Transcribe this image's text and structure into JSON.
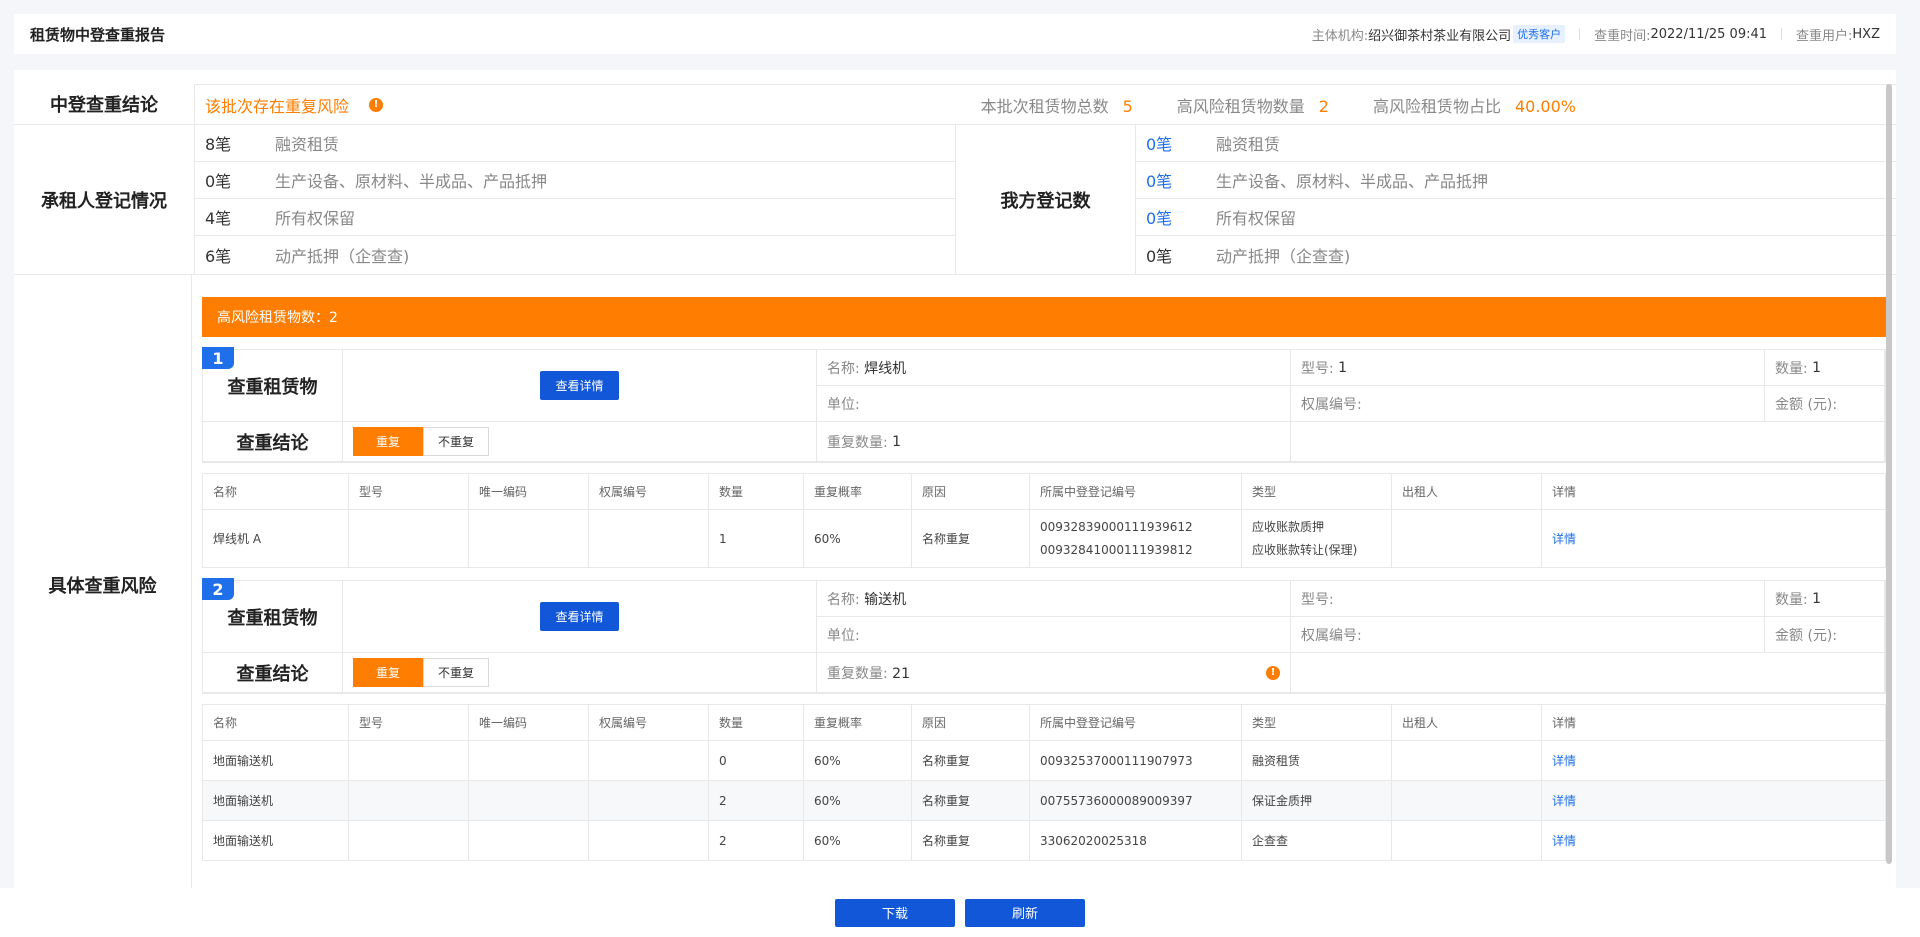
{
  "header": {
    "title": "租赁物中登查重报告",
    "org_label": "主体机构:",
    "org_value": "绍兴御茶村茶业有限公司",
    "vip_tag": "优秀客户",
    "time_label": "查重时间:",
    "time_value": "2022/11/25 09:41",
    "user_label": "查重用户:",
    "user_value": "HXZ"
  },
  "conclusion": {
    "label": "中登查重结论",
    "text": "该批次存在重复风险",
    "total_label": "本批次租赁物总数",
    "total_value": "5",
    "high_label": "高风险租赁物数量",
    "high_value": "2",
    "ratio_label": "高风险租赁物占比",
    "ratio_value": "40.00%"
  },
  "lessee": {
    "label": "承租人登记情况",
    "items": [
      {
        "count": "8笔",
        "type": "融资租赁"
      },
      {
        "count": "0笔",
        "type": "生产设备、原材料、半成品、产品抵押"
      },
      {
        "count": "4笔",
        "type": "所有权保留"
      },
      {
        "count": "6笔",
        "type": "动产抵押（企查查)"
      }
    ]
  },
  "ours": {
    "label": "我方登记数",
    "items": [
      {
        "count": "0笔",
        "type": "融资租赁"
      },
      {
        "count": "0笔",
        "type": "生产设备、原材料、半成品、产品抵押"
      },
      {
        "count": "0笔",
        "type": "所有权保留"
      },
      {
        "count": "0笔",
        "type": "动产抵押（企查查)"
      }
    ]
  },
  "risk": {
    "label": "具体查重风险",
    "bar_text": "高风险租赁物数：2",
    "item_label": "查重租赁物",
    "result_label": "查重结论",
    "detail_button": "查看详情",
    "dup_on": "重复",
    "dup_off": "不重复",
    "name_key": "名称:",
    "model_key": "型号:",
    "qty_key": "数量:",
    "unit_key": "单位:",
    "right_key": "权属编号:",
    "amount_key": "金额 (元):",
    "dup_qty_key": "重复数量:",
    "columns": [
      "名称",
      "型号",
      "唯一编码",
      "权属编号",
      "数量",
      "重复概率",
      "原因",
      "所属中登登记编号",
      "类型",
      "出租人",
      "详情"
    ],
    "items": [
      {
        "index": "1",
        "name": "焊线机",
        "model": "1",
        "qty": "1",
        "dup_qty": "1",
        "rows": [
          {
            "name": "焊线机 A",
            "qty": "1",
            "prob": "60%",
            "reason": "名称重复",
            "reg1": "00932839000111939612",
            "reg2": "00932841000111939812",
            "type1": "应收账款质押",
            "type2": "应收账款转让(保理)",
            "link": "详情"
          }
        ]
      },
      {
        "index": "2",
        "name": "输送机",
        "model": "",
        "qty": "1",
        "dup_qty": "21",
        "rows": [
          {
            "name": "地面输送机",
            "qty": "0",
            "prob": "60%",
            "reason": "名称重复",
            "reg1": "00932537000111907973",
            "type1": "融资租赁",
            "link": "详情"
          },
          {
            "name": "地面输送机",
            "qty": "2",
            "prob": "60%",
            "reason": "名称重复",
            "reg1": "00755736000089009397",
            "type1": "保证金质押",
            "link": "详情"
          },
          {
            "name": "地面输送机",
            "qty": "2",
            "prob": "60%",
            "reason": "名称重复",
            "reg1": "33062020025318",
            "type1": "企查查",
            "link": "详情"
          }
        ]
      }
    ]
  },
  "footer": {
    "download": "下载",
    "refresh": "刷新"
  }
}
